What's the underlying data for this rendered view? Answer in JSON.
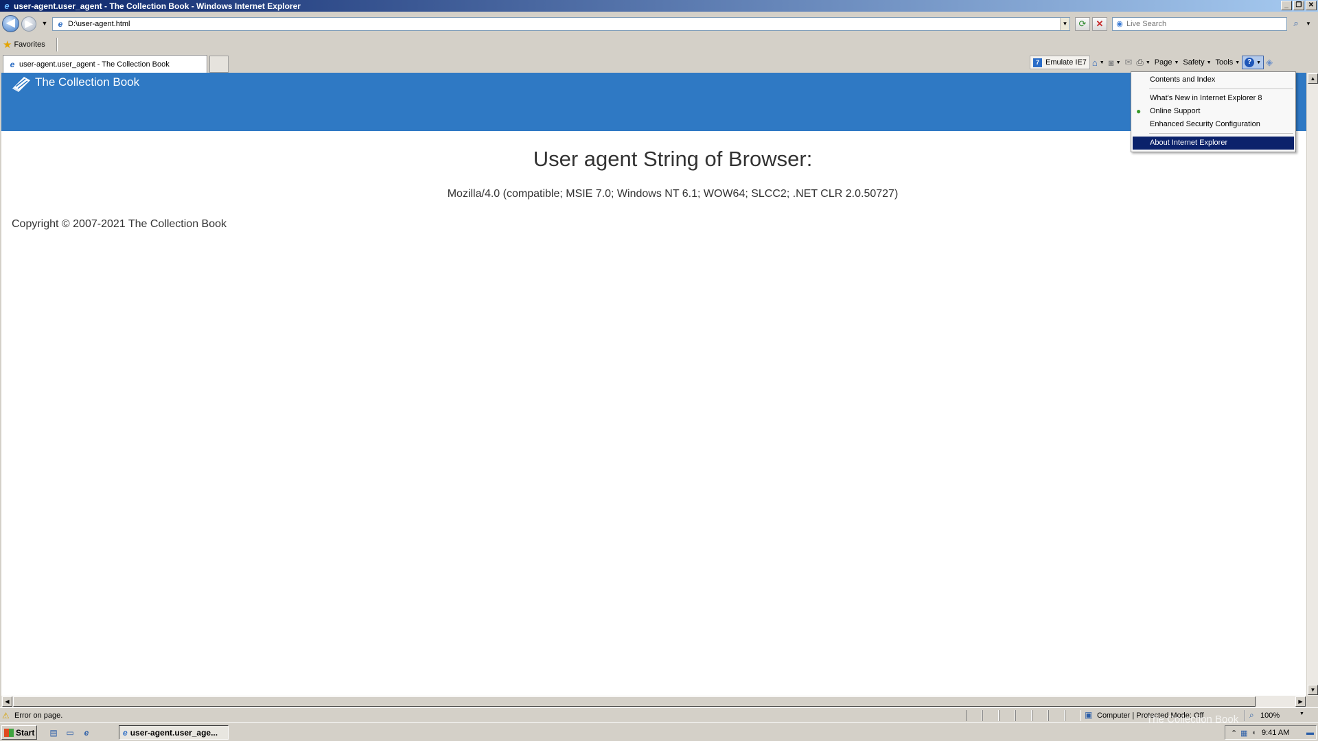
{
  "window": {
    "title": "user-agent.user_agent - The Collection Book - Windows Internet Explorer"
  },
  "address_bar": {
    "url": "D:\\user-agent.html"
  },
  "search": {
    "placeholder": "Live Search"
  },
  "favorites": {
    "label": "Favorites"
  },
  "tab": {
    "title": "user-agent.user_agent - The Collection Book"
  },
  "command_bar": {
    "emulate": "Emulate IE7",
    "page": "Page",
    "safety": "Safety",
    "tools": "Tools"
  },
  "help_menu": {
    "items": [
      "Contents and Index",
      "What's New in Internet Explorer 8",
      "Online Support",
      "Enhanced Security Configuration",
      "About Internet Explorer"
    ]
  },
  "site": {
    "name": "The Collection Book",
    "heading": "User agent String of Browser:",
    "user_agent": "Mozilla/4.0 (compatible; MSIE 7.0; Windows NT 6.1; WOW64; SLCC2; .NET CLR 2.0.50727)",
    "copyright": "Copyright © 2007-2021 The Collection Book",
    "header_color": "#2f79c4"
  },
  "status_bar": {
    "message": "Error on page.",
    "zone": "Computer | Protected Mode: Off",
    "zoom": "100%"
  },
  "taskbar": {
    "start": "Start",
    "task_ie": "user-agent.user_age...",
    "clock": "9:41 AM"
  },
  "watermark": "The Collection Book"
}
